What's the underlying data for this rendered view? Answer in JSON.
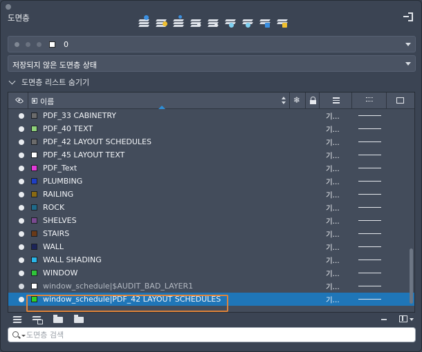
{
  "panel": {
    "title": "도면층"
  },
  "toolbar": {
    "buttons": [
      {
        "name": "new-layer-icon"
      },
      {
        "name": "new-layer-vp-frozen-icon"
      },
      {
        "name": "delete-layer-icon"
      },
      {
        "name": "set-current-icon"
      },
      {
        "name": "layer-states-icon"
      },
      {
        "name": "freeze-icon"
      },
      {
        "name": "isolate-icon"
      },
      {
        "name": "lock-icon"
      },
      {
        "name": "unlock-icon"
      }
    ]
  },
  "current_layer": {
    "name": "0",
    "swatch_color": "#ffffff"
  },
  "layer_state": {
    "label": "저장되지 않은 도면층 상태"
  },
  "collapse": {
    "label": "도면층 리스트 숨기기"
  },
  "table": {
    "columns": {
      "name": "이름"
    },
    "rows": [
      {
        "name": "PDF_33 CABINETRY",
        "color": "#6b6b6b",
        "linetype": "기...",
        "dim": false
      },
      {
        "name": "PDF_40 TEXT",
        "color": "#8fd17a",
        "linetype": "기...",
        "dim": false
      },
      {
        "name": "PDF_42 LAYOUT SCHEDULES",
        "color": "#6b6b6b",
        "linetype": "기...",
        "dim": false
      },
      {
        "name": "PDF_45 LAYOUT TEXT",
        "color": "#ffffff",
        "linetype": "기...",
        "dim": false
      },
      {
        "name": "PDF_Text",
        "color": "#e23bd8",
        "linetype": "기...",
        "dim": false
      },
      {
        "name": "PLUMBING",
        "color": "#1f3fc4",
        "linetype": "기...",
        "dim": false
      },
      {
        "name": "RAILING",
        "color": "#8a6a12",
        "linetype": "기...",
        "dim": false
      },
      {
        "name": "ROCK",
        "color": "#1f6a8a",
        "linetype": "기...",
        "dim": false
      },
      {
        "name": "SHELVES",
        "color": "#7a4a90",
        "linetype": "기...",
        "dim": false
      },
      {
        "name": "STAIRS",
        "color": "#6a3a18",
        "linetype": "기...",
        "dim": false
      },
      {
        "name": "WALL",
        "color": "#1c2458",
        "linetype": "기...",
        "dim": false
      },
      {
        "name": "WALL SHADING",
        "color": "#29b6e8",
        "linetype": "기...",
        "dim": false
      },
      {
        "name": "WINDOW",
        "color": "#2fc43a",
        "linetype": "기...",
        "dim": false
      },
      {
        "name": "window_schedule|$AUDIT_BAD_LAYER1",
        "color": "#ffffff",
        "linetype": "기...",
        "dim": true
      },
      {
        "name": "window_schedule|PDF_42 LAYOUT SCHEDULES",
        "color": "#2fd12a",
        "linetype": "기...",
        "dim": false,
        "selected": true
      }
    ]
  },
  "search": {
    "placeholder": "도면층 검색",
    "value": ""
  },
  "colors": {
    "selection": "#1f76b8",
    "highlight_border": "#e0843a"
  }
}
